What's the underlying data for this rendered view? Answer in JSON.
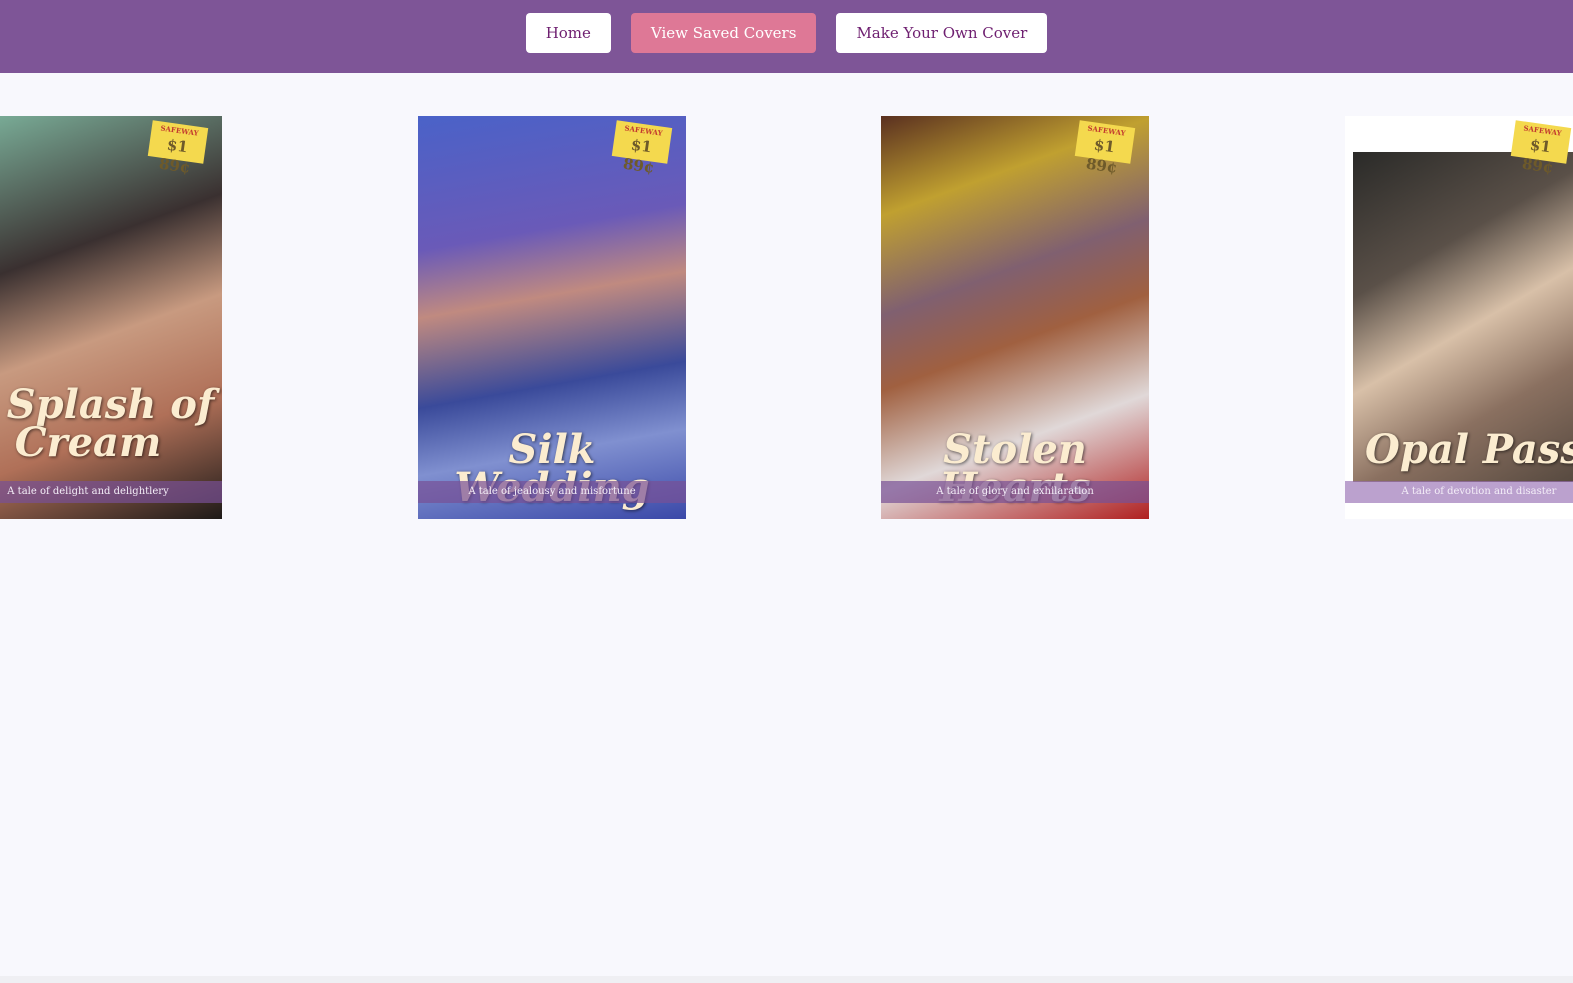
{
  "nav": {
    "home": "Home",
    "saved": "View Saved Covers",
    "make": "Make Your Own Cover"
  },
  "covers": [
    {
      "title": "A Splash of Cream",
      "tagline": "A tale of delight and delightlery",
      "sticker_brand": "SAFEWAY",
      "sticker_price": "$1 89¢"
    },
    {
      "title": "Silk Wedding",
      "tagline": "A tale of jealousy and misfortune",
      "sticker_brand": "SAFEWAY",
      "sticker_price": "$1 89¢"
    },
    {
      "title": "Stolen Hearts",
      "tagline": "A tale of glory and exhilaration",
      "sticker_brand": "SAFEWAY",
      "sticker_price": "$1 89¢"
    },
    {
      "title": "Opal Passion",
      "tagline": "A tale of devotion and disaster",
      "sticker_brand": "SAFEWAY",
      "sticker_price": "$1 89¢"
    }
  ]
}
